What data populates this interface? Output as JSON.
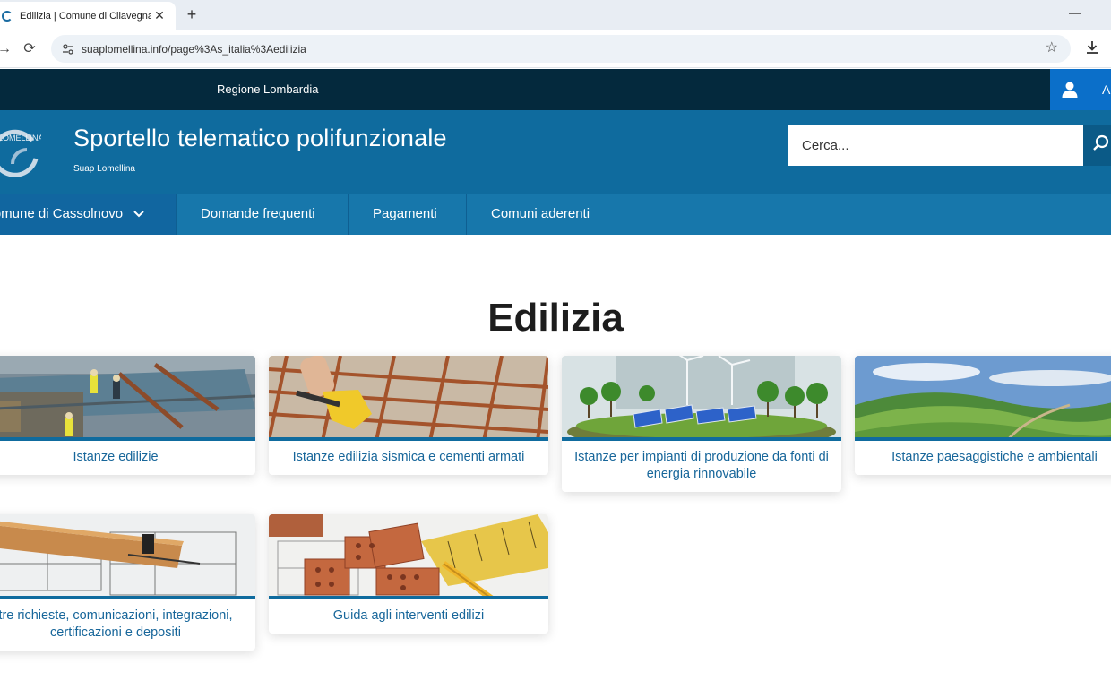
{
  "browser": {
    "tab_title": "Edilizia | Comune di Cilavegna",
    "tab_close": "✕",
    "new_tab": "+",
    "url": "suaplomellina.info/page%3As_italia%3Aedilizia"
  },
  "topbar": {
    "region": "Regione Lombardia",
    "login_label": "A"
  },
  "header": {
    "logo_text": "LOMELLINA",
    "title": "Sportello telematico polifunzionale",
    "subtitle": "Suap Lomellina",
    "search_placeholder": "Cerca..."
  },
  "nav": {
    "items": [
      {
        "label": "Comune di Cassolnovo"
      },
      {
        "label": "Domande frequenti"
      },
      {
        "label": "Pagamenti"
      },
      {
        "label": "Comuni aderenti"
      }
    ]
  },
  "main": {
    "title": "Edilizia",
    "cards": [
      {
        "label": "Istanze edilizie",
        "image": "construction-site"
      },
      {
        "label": "Istanze edilizia sismica e cementi armati",
        "image": "rebar-gloves"
      },
      {
        "label": "Istanze per impianti di produzione da fonti di energia rinnovabile",
        "image": "solar-wind"
      },
      {
        "label": "Istanze paesaggistiche e ambientali",
        "image": "green-hills"
      },
      {
        "label": "tre richieste, comunicazioni, integrazioni, certificazioni e depositi",
        "image": "blueprint-ruler"
      },
      {
        "label": "Guida agli interventi edilizi",
        "image": "bricks-pencil"
      }
    ]
  },
  "colors": {
    "topbar": "#04293d",
    "header": "#0f6b9e",
    "nav": "#1777ab",
    "accent": "#0b6fc9",
    "card_text": "#17669a"
  }
}
